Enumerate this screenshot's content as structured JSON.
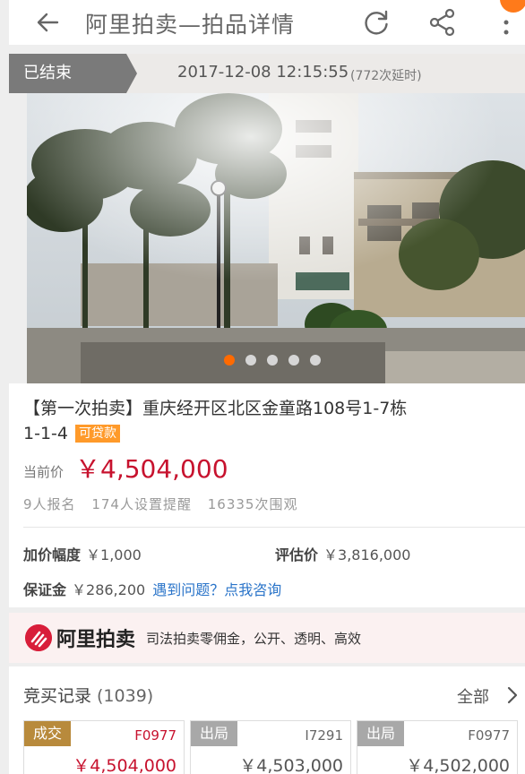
{
  "header": {
    "title": "阿里拍卖—拍品详情",
    "icons": [
      "back-arrow-icon",
      "refresh-icon",
      "share-icon",
      "more-icon"
    ]
  },
  "status": {
    "label": "已结束",
    "end_time": "2017-12-08 12:15:55",
    "delay": "(772次延时)"
  },
  "gallery": {
    "photo": "building-photo",
    "slide_count": 5,
    "active_slide": 1
  },
  "lot": {
    "title": "【第一次拍卖】重庆经开区北区金童路108号1-7栋1-1-4",
    "loan_tag": "可贷款",
    "price_label": "当前价",
    "price_value": "￥4,504,000",
    "stats": {
      "signups": "9人报名",
      "reminders": "174人设置提醒",
      "views": "16335次围观"
    },
    "increment_label": "加价幅度",
    "increment_value": "￥1,000",
    "appraisal_label": "评估价",
    "appraisal_value": "￥3,816,000",
    "deposit_label": "保证金",
    "deposit_value": "￥286,200",
    "consult_link": "遇到问题？点我咨询"
  },
  "brand": {
    "name": "阿里拍卖",
    "slogan": "司法拍卖零佣金，公开、透明、高效"
  },
  "records": {
    "title": "竞买记录",
    "count": "(1039)",
    "all_label": "全部",
    "items": [
      {
        "status": "成交",
        "bidder": "F0977",
        "amount": "￥4,504,000"
      },
      {
        "status": "出局",
        "bidder": "I7291",
        "amount": "￥4,503,000"
      },
      {
        "status": "出局",
        "bidder": "F0977",
        "amount": "￥4,502,000"
      }
    ]
  },
  "colors": {
    "price_red": "#c7122e",
    "accent_orange": "#ff6a00",
    "deal_gold": "#b88a3c",
    "link_blue": "#2a74c9"
  }
}
